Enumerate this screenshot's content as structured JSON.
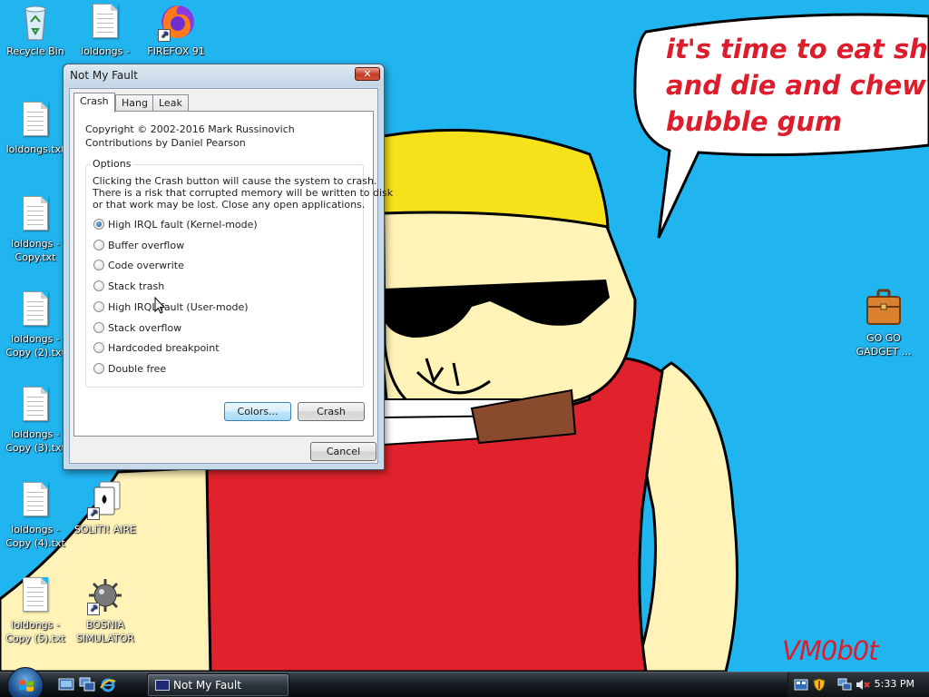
{
  "desktop": {
    "icons": [
      {
        "label": "Recycle Bin"
      },
      {
        "label": "loldongs -"
      },
      {
        "label": "FIREFOX 91"
      },
      {
        "label": "loldongs.txt"
      },
      {
        "label": "loldongs -\nCopy.txt"
      },
      {
        "label": "loldongs -\nCopy (2).txt"
      },
      {
        "label": "loldongs -\nCopy (3).txt"
      },
      {
        "label": "loldongs -\nCopy (4).txt"
      },
      {
        "label": "SOLITI! AIRE"
      },
      {
        "label": "loldongs -\nCopy (5).txt"
      },
      {
        "label": "BOSNIA\nSIMULATOR"
      },
      {
        "label": "GO GO\nGADGET ..."
      }
    ]
  },
  "wallpaper": {
    "speech_bubble": "it's time to eat shit\nand die and chew\nbubble gum",
    "signature": "VM0b0t",
    "colors": {
      "sky": "#21b5f0",
      "text_red": "#dd1c2c",
      "shirt_red": "#e0222c",
      "hair_yellow": "#f7e11a",
      "skin": "#fff3b8"
    }
  },
  "dialog": {
    "title": "Not My Fault",
    "close_label": "✕",
    "tabs": [
      {
        "label": "Crash",
        "active": true
      },
      {
        "label": "Hang",
        "active": false
      },
      {
        "label": "Leak",
        "active": false
      }
    ],
    "copyright_line1": "Copyright © 2002-2016 Mark Russinovich",
    "copyright_line2": "Contributions by Daniel Pearson",
    "options_legend": "Options",
    "warning_line1": "Clicking the Crash button will cause the system to crash.",
    "warning_line2": "There is a risk that corrupted memory will be written to disk",
    "warning_line3": "or that work may be lost. Close any open applications.",
    "options": [
      {
        "label": "High IRQL fault (Kernel-mode)",
        "selected": true
      },
      {
        "label": "Buffer overflow",
        "selected": false
      },
      {
        "label": "Code overwrite",
        "selected": false
      },
      {
        "label": "Stack trash",
        "selected": false
      },
      {
        "label": "High IRQL fault (User-mode)",
        "selected": false
      },
      {
        "label": "Stack overflow",
        "selected": false
      },
      {
        "label": "Hardcoded breakpoint",
        "selected": false
      },
      {
        "label": "Double free",
        "selected": false
      }
    ],
    "colors_button": "Colors...",
    "crash_button": "Crash",
    "cancel_button": "Cancel"
  },
  "taskbar": {
    "task_button": "Not My Fault",
    "clock": "5:33 PM"
  }
}
